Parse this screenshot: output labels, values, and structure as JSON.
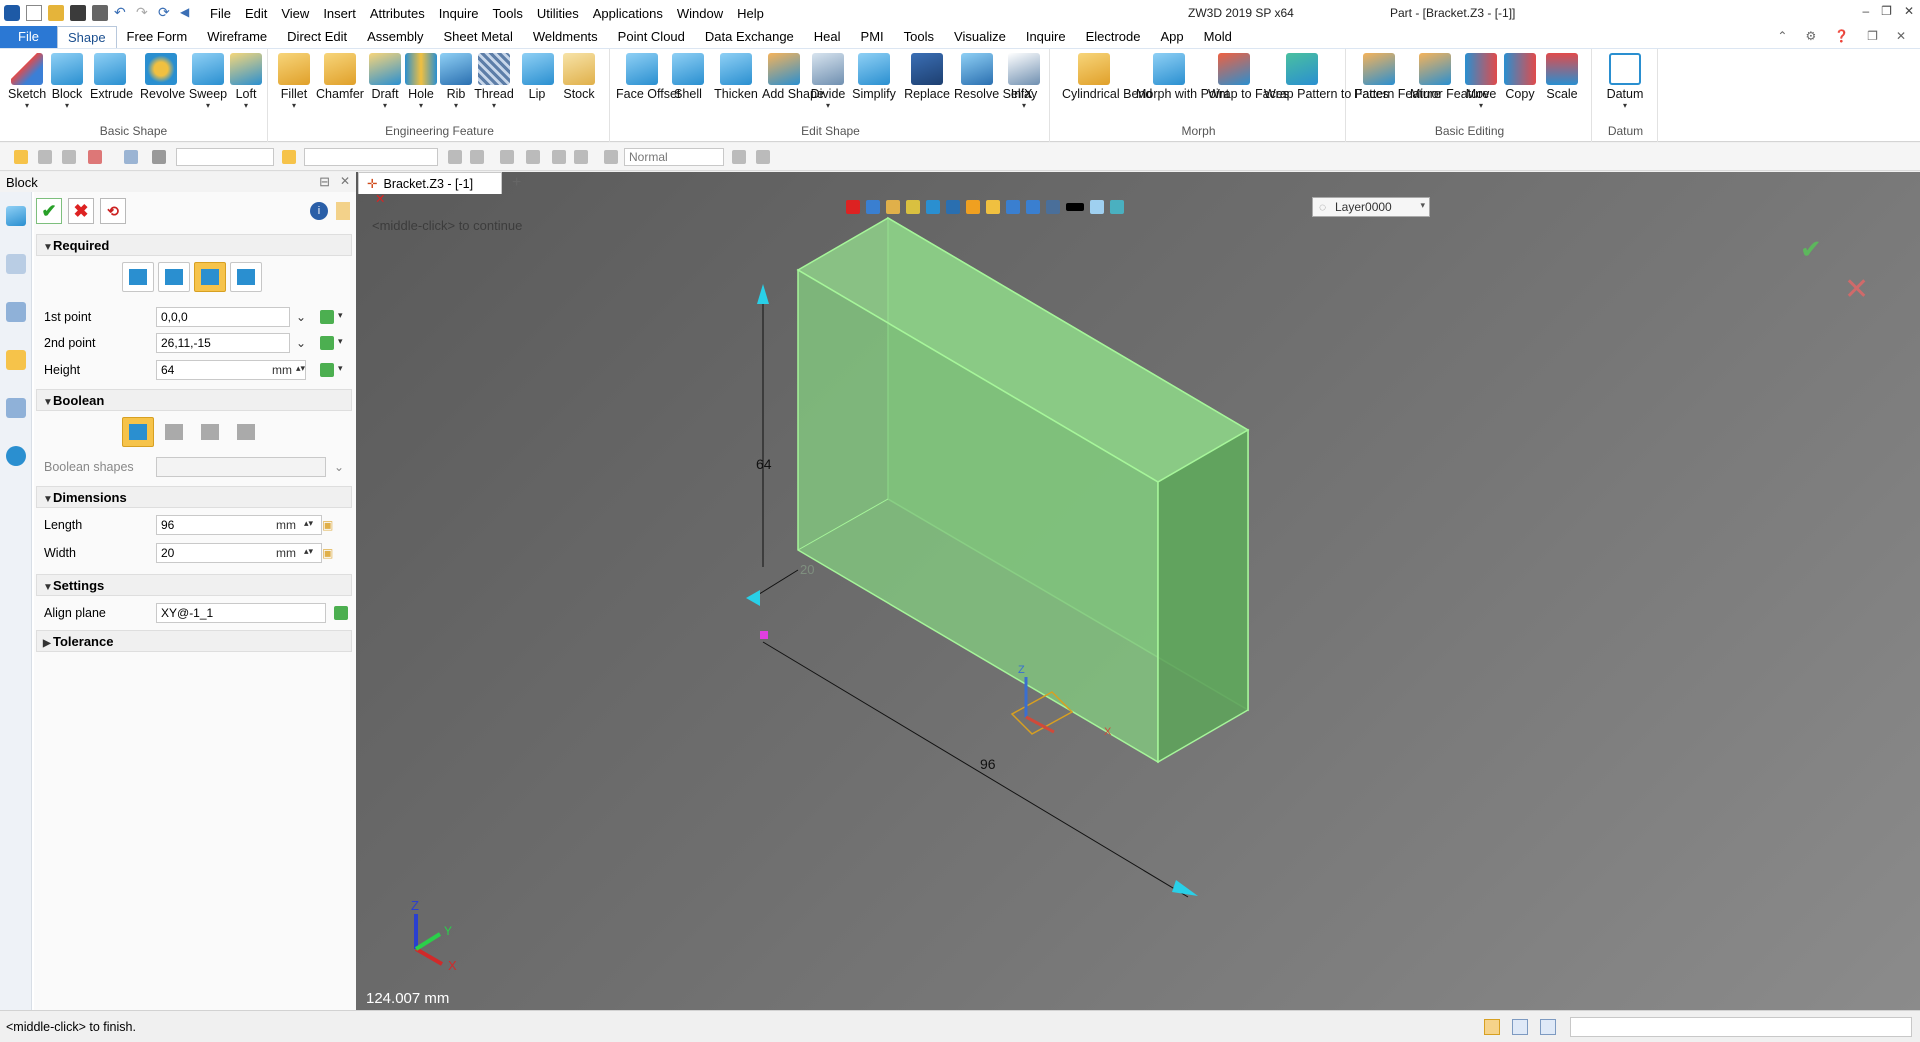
{
  "app": {
    "title": "ZW3D 2019 SP x64",
    "document": "Part - [Bracket.Z3 - [-1]]",
    "window_controls": [
      "–",
      "❐",
      "✕"
    ]
  },
  "menubar": [
    "File",
    "Edit",
    "View",
    "Insert",
    "Attributes",
    "Inquire",
    "Tools",
    "Utilities",
    "Applications",
    "Window",
    "Help"
  ],
  "ribbon_tabs": [
    "File",
    "Shape",
    "Free Form",
    "Wireframe",
    "Direct Edit",
    "Assembly",
    "Sheet Metal",
    "Weldments",
    "Point Cloud",
    "Data Exchange",
    "Heal",
    "PMI",
    "Tools",
    "Visualize",
    "Inquire",
    "Electrode",
    "App",
    "Mold"
  ],
  "ribbon_active_tab": "Shape",
  "ribbon_groups": {
    "basic_shape": {
      "label": "Basic Shape",
      "buttons": [
        "Sketch",
        "Block",
        "Extrude",
        "Revolve",
        "Sweep",
        "Loft"
      ]
    },
    "engineering_feature": {
      "label": "Engineering Feature",
      "buttons": [
        "Fillet",
        "Chamfer",
        "Draft",
        "Hole",
        "Rib",
        "Thread",
        "Lip",
        "Stock"
      ]
    },
    "edit_shape": {
      "label": "Edit Shape",
      "buttons": [
        "Face Offset",
        "Shell",
        "Thicken",
        "Add Shape",
        "Divide",
        "Simplify",
        "Replace",
        "Resolve SelfX",
        "Inlay"
      ]
    },
    "morph": {
      "label": "Morph",
      "buttons": [
        "Cylindrical Bend",
        "Morph with Point",
        "Wrap to Faces",
        "Wrap Pattern to Faces"
      ]
    },
    "basic_editing": {
      "label": "Basic Editing",
      "buttons": [
        "Pattern Feature",
        "Mirror Feature",
        "Move",
        "Copy",
        "Scale"
      ]
    },
    "datum": {
      "label": "Datum",
      "buttons": [
        "Datum"
      ]
    }
  },
  "toolbar2": {
    "render_mode": "Normal"
  },
  "panel": {
    "title": "Block",
    "required": {
      "header": "Required",
      "first_point_label": "1st point",
      "first_point_value": "0,0,0",
      "second_point_label": "2nd point",
      "second_point_value": "26,11,-15",
      "height_label": "Height",
      "height_value": "64",
      "height_unit": "mm"
    },
    "boolean": {
      "header": "Boolean",
      "shapes_label": "Boolean shapes"
    },
    "dimensions": {
      "header": "Dimensions",
      "length_label": "Length",
      "length_value": "96",
      "length_unit": "mm",
      "width_label": "Width",
      "width_value": "20",
      "width_unit": "mm"
    },
    "settings": {
      "header": "Settings",
      "align_label": "Align plane",
      "align_value": "XY@-1_1"
    },
    "tolerance": {
      "header": "Tolerance"
    }
  },
  "viewport": {
    "doc_tab": "Bracket.Z3 - [-1]",
    "layer": "Layer0000",
    "prompt": "<middle-click> to continue",
    "dim_height": "64",
    "dim_length": "96",
    "dim_width": "20",
    "measure_readout": "124.007 mm",
    "axes": {
      "x": "X",
      "y": "Y",
      "z": "Z"
    }
  },
  "status": {
    "text": "<middle-click> to finish."
  },
  "colors": {
    "accent": "#2b78d4",
    "selected_button": "#f6c34a",
    "block_fill": "#7fc47a",
    "block_edge": "#a6f59a"
  }
}
